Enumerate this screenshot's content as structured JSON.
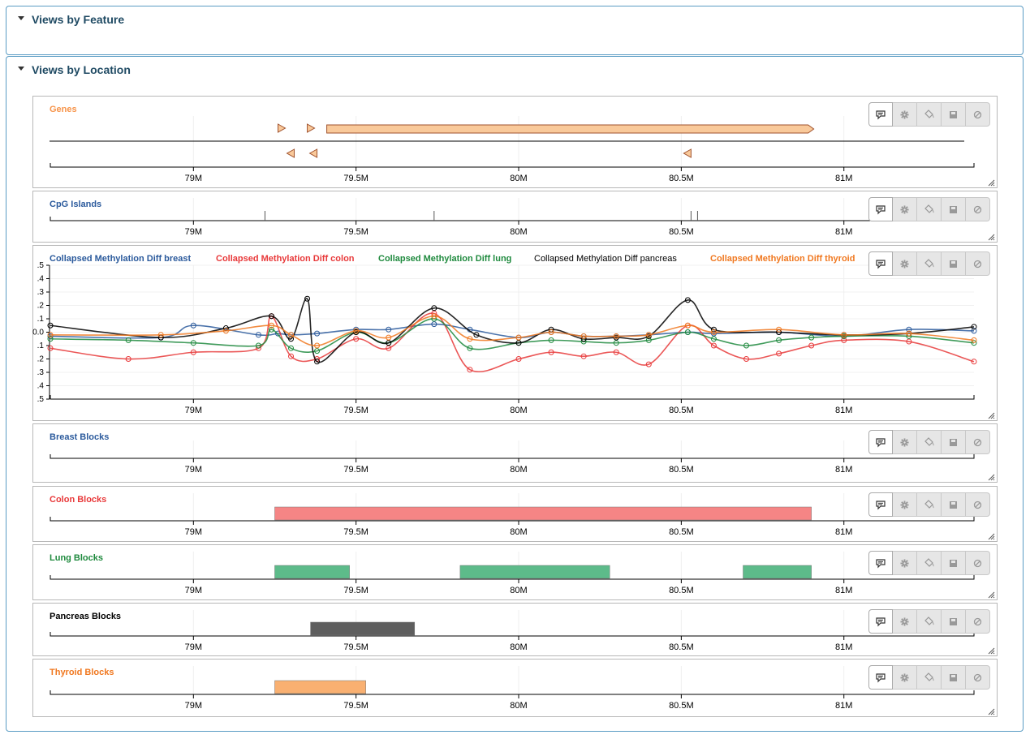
{
  "panels": {
    "feature": {
      "title": "Views by Feature"
    },
    "location": {
      "title": "Views by Location"
    }
  },
  "axis": {
    "min": 78.56,
    "max": 81.4,
    "ticks": [
      79,
      79.5,
      80,
      80.5,
      81
    ],
    "tick_labels": [
      "79M",
      "79.5M",
      "80M",
      "80.5M",
      "81M"
    ]
  },
  "toolbar_icons": [
    "comment-icon",
    "gear-icon",
    "paint-bucket-icon",
    "save-icon",
    "block-icon"
  ],
  "tracks": {
    "genes": {
      "label": "Genes",
      "color": "#f7944a",
      "forward_markers": [
        79.27,
        79.36
      ],
      "reverse_markers": [
        79.3,
        79.37,
        80.52
      ],
      "gene": {
        "start": 79.41,
        "end": 80.89,
        "fill": "#f9c99a",
        "stroke": "#a0522d"
      }
    },
    "cpg": {
      "label": "CpG Islands",
      "color": "#2b5a9c",
      "islands": [
        79.22,
        79.74,
        80.53,
        80.55
      ]
    },
    "methylation": {
      "legend": [
        {
          "label": "Collapsed Methylation Diff breast",
          "color": "#2b5a9c"
        },
        {
          "label": "Collapsed Methylation Diff colon",
          "color": "#e8393a"
        },
        {
          "label": "Collapsed Methylation Diff lung",
          "color": "#1f8a3e"
        },
        {
          "label": "Collapsed Methylation Diff pancreas",
          "color": "#000000"
        },
        {
          "label": "Collapsed Methylation Diff thyroid",
          "color": "#f07820"
        }
      ],
      "y_ticks": [
        0.5,
        0.4,
        0.3,
        0.2,
        0.1,
        0.0,
        -0.1,
        -0.2,
        -0.3,
        -0.4,
        -0.5
      ],
      "y_tick_labels": [
        ".5",
        ".4",
        ".3",
        ".2",
        ".1",
        "0.0",
        ".1",
        ".2",
        ".3",
        ".4",
        ".5"
      ]
    },
    "breast": {
      "label": "Breast Blocks",
      "color": "#2b5a9c",
      "blocks": []
    },
    "colon": {
      "label": "Colon Blocks",
      "color": "#e8393a",
      "fill": "#f58585",
      "blocks": [
        [
          79.25,
          80.9
        ]
      ]
    },
    "lung": {
      "label": "Lung Blocks",
      "color": "#1f8a3e",
      "fill": "#5dbb8a",
      "blocks": [
        [
          79.25,
          79.48
        ],
        [
          79.82,
          80.28
        ],
        [
          80.69,
          80.9
        ]
      ]
    },
    "pancreas": {
      "label": "Pancreas Blocks",
      "color": "#000000",
      "fill": "#5e5e5e",
      "blocks": [
        [
          79.36,
          79.68
        ]
      ]
    },
    "thyroid": {
      "label": "Thyroid Blocks",
      "color": "#f07820",
      "fill": "#f9b071",
      "blocks": [
        [
          79.25,
          79.53
        ]
      ]
    }
  },
  "chart_data": {
    "type": "line",
    "title": "",
    "xlabel": "",
    "ylabel": "",
    "xlim": [
      78.56,
      81.4
    ],
    "ylim": [
      -0.5,
      0.5
    ],
    "x_unit": "M",
    "series": [
      {
        "name": "Collapsed Methylation Diff breast",
        "color": "#2b5a9c",
        "x": [
          78.56,
          78.9,
          79.0,
          79.2,
          79.26,
          79.3,
          79.38,
          79.5,
          79.6,
          79.74,
          79.85,
          80.0,
          80.1,
          80.2,
          80.3,
          80.4,
          80.52,
          80.6,
          80.8,
          81.0,
          81.2,
          81.4
        ],
        "y": [
          -0.03,
          -0.04,
          0.05,
          -0.02,
          -0.01,
          -0.02,
          -0.01,
          0.02,
          0.02,
          0.06,
          0.02,
          -0.04,
          0.0,
          -0.03,
          -0.03,
          -0.02,
          0.0,
          -0.01,
          0.0,
          -0.03,
          0.02,
          0.01
        ]
      },
      {
        "name": "Collapsed Methylation Diff colon",
        "color": "#e8393a",
        "x": [
          78.56,
          78.8,
          79.0,
          79.2,
          79.24,
          79.3,
          79.38,
          79.5,
          79.6,
          79.74,
          79.85,
          80.0,
          80.1,
          80.2,
          80.3,
          80.4,
          80.52,
          80.6,
          80.7,
          80.8,
          80.9,
          81.0,
          81.2,
          81.4
        ],
        "y": [
          -0.12,
          -0.2,
          -0.15,
          -0.12,
          0.12,
          -0.18,
          -0.2,
          -0.05,
          -0.12,
          0.14,
          -0.28,
          -0.2,
          -0.15,
          -0.18,
          -0.15,
          -0.24,
          0.05,
          -0.1,
          -0.2,
          -0.16,
          -0.1,
          -0.06,
          -0.07,
          -0.22
        ]
      },
      {
        "name": "Collapsed Methylation Diff lung",
        "color": "#1f8a3e",
        "x": [
          78.56,
          78.8,
          79.0,
          79.2,
          79.24,
          79.3,
          79.38,
          79.5,
          79.6,
          79.74,
          79.85,
          80.0,
          80.1,
          80.2,
          80.3,
          80.4,
          80.52,
          80.6,
          80.7,
          80.8,
          80.9,
          81.0,
          81.2,
          81.4
        ],
        "y": [
          -0.05,
          -0.06,
          -0.08,
          -0.1,
          0.02,
          -0.12,
          -0.14,
          0.0,
          -0.08,
          0.1,
          -0.12,
          -0.08,
          -0.06,
          -0.07,
          -0.08,
          -0.06,
          0.0,
          -0.05,
          -0.1,
          -0.06,
          -0.04,
          -0.03,
          -0.03,
          -0.08
        ]
      },
      {
        "name": "Collapsed Methylation Diff pancreas",
        "color": "#000000",
        "x": [
          78.56,
          78.9,
          79.1,
          79.24,
          79.3,
          79.35,
          79.38,
          79.5,
          79.6,
          79.74,
          79.87,
          80.0,
          80.1,
          80.2,
          80.3,
          80.4,
          80.52,
          80.6,
          80.8,
          81.0,
          81.2,
          81.4
        ],
        "y": [
          0.05,
          -0.04,
          0.03,
          0.12,
          -0.05,
          0.25,
          -0.22,
          0.0,
          -0.08,
          0.18,
          -0.02,
          -0.08,
          0.02,
          -0.05,
          -0.04,
          -0.03,
          0.24,
          0.02,
          0.0,
          -0.02,
          -0.01,
          0.04
        ]
      },
      {
        "name": "Collapsed Methylation Diff thyroid",
        "color": "#f07820",
        "x": [
          78.56,
          78.9,
          79.1,
          79.24,
          79.3,
          79.38,
          79.5,
          79.6,
          79.74,
          79.85,
          80.0,
          80.1,
          80.2,
          80.3,
          80.4,
          80.52,
          80.6,
          80.8,
          81.0,
          81.2,
          81.4
        ],
        "y": [
          -0.02,
          -0.02,
          0.01,
          0.05,
          -0.02,
          -0.1,
          0.01,
          -0.04,
          0.12,
          -0.05,
          -0.04,
          0.0,
          -0.03,
          -0.03,
          -0.02,
          0.05,
          0.0,
          0.02,
          -0.02,
          -0.01,
          -0.06
        ]
      }
    ]
  }
}
